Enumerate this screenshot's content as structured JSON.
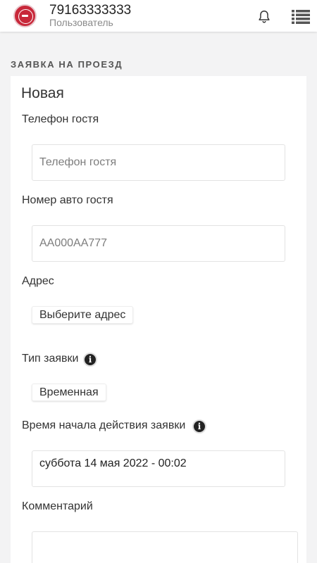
{
  "header": {
    "phone": "79163333333",
    "role": "Пользователь",
    "logo_icon": "emblem-logo-icon",
    "bell_icon": "bell-icon",
    "menu_icon": "list-menu-icon"
  },
  "section_title": "ЗАЯВКА НА ПРОЕЗД",
  "form": {
    "title": "Новая",
    "guest_phone": {
      "label": "Телефон гостя",
      "value": "",
      "placeholder": "Телефон гостя"
    },
    "guest_car": {
      "label": "Номер авто гостя",
      "value": "",
      "placeholder": "AA000AA777"
    },
    "address": {
      "label": "Адрес",
      "button": "Выберите адрес"
    },
    "request_type": {
      "label": "Тип заявки",
      "value": "Временная",
      "info_icon": "info-icon"
    },
    "start_time": {
      "label": "Время начала действия заявки",
      "value": "суббота 14 мая 2022 - 00:02",
      "info_icon": "info-icon"
    },
    "comment": {
      "label": "Комментарий",
      "value": ""
    }
  },
  "colors": {
    "accent": "#c8283a",
    "background": "#f3f3f4",
    "card": "#ffffff"
  }
}
